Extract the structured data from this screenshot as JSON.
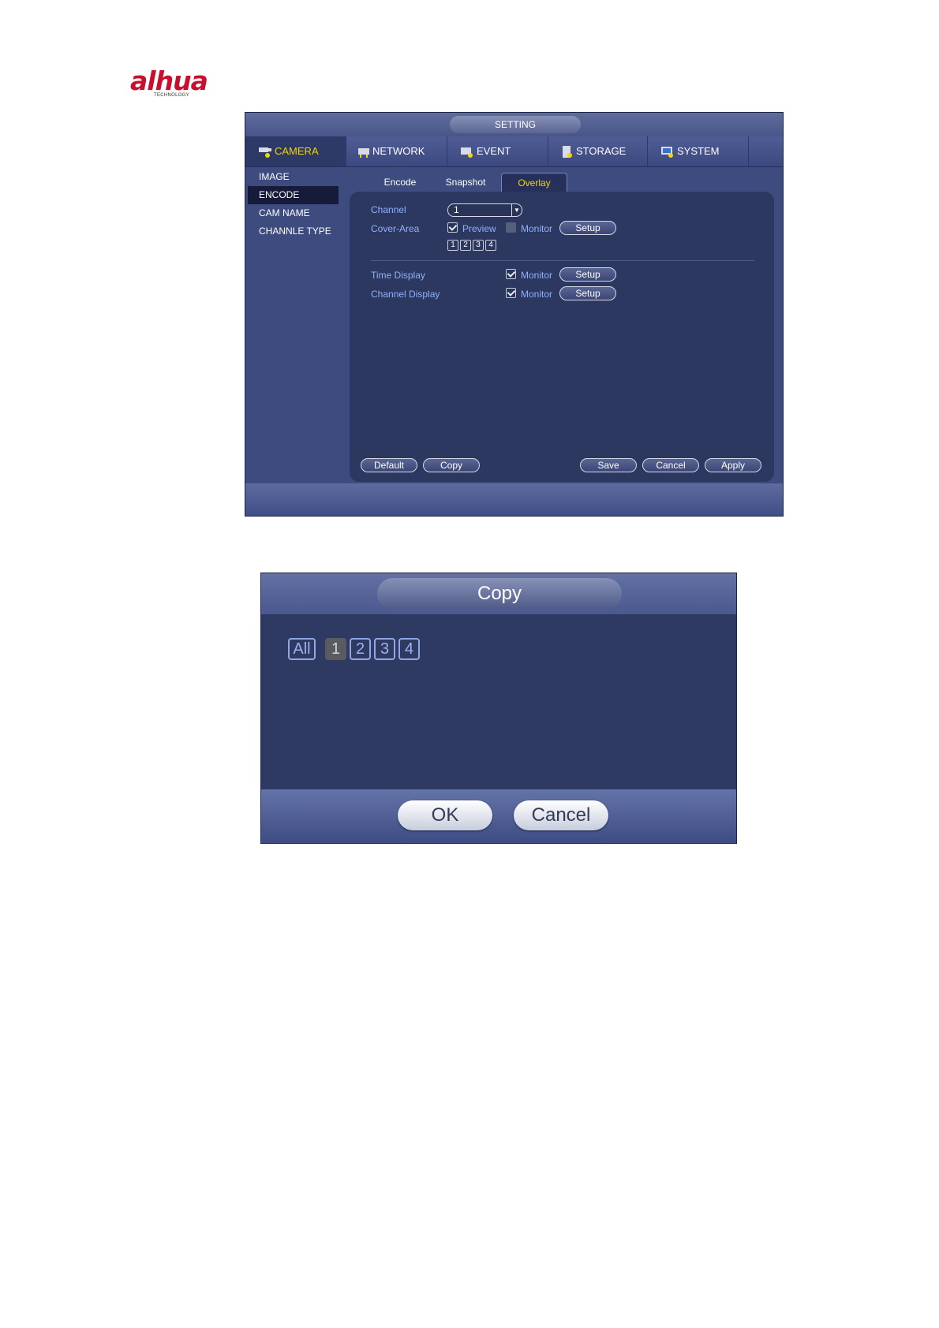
{
  "logo": {
    "text": "alhua",
    "sub": "TECHNOLOGY"
  },
  "setting": {
    "title": "SETTING",
    "nav": [
      {
        "label": "CAMERA",
        "icon": "camera-icon"
      },
      {
        "label": "NETWORK",
        "icon": "network-icon"
      },
      {
        "label": "EVENT",
        "icon": "event-icon"
      },
      {
        "label": "STORAGE",
        "icon": "storage-icon"
      },
      {
        "label": "SYSTEM",
        "icon": "system-icon"
      }
    ],
    "sidebar": [
      "IMAGE",
      "ENCODE",
      "CAM NAME",
      "CHANNLE TYPE"
    ],
    "subtabs": [
      "Encode",
      "Snapshot",
      "Overlay"
    ],
    "channel_label": "Channel",
    "channel_value": "1",
    "cover_area_label": "Cover-Area",
    "preview_label": "Preview",
    "monitor_label": "Monitor",
    "setup_label": "Setup",
    "channels": [
      "1",
      "2",
      "3",
      "4"
    ],
    "time_display_label": "Time Display",
    "channel_display_label": "Channel Display",
    "buttons": {
      "default": "Default",
      "copy": "Copy",
      "save": "Save",
      "cancel": "Cancel",
      "apply": "Apply"
    }
  },
  "copy_dialog": {
    "title": "Copy",
    "all_label": "All",
    "channels": [
      "1",
      "2",
      "3",
      "4"
    ],
    "ok": "OK",
    "cancel": "Cancel"
  },
  "colors": {
    "accent": "#f5d400",
    "panel": "#2d3860",
    "label": "#8fb0ff"
  }
}
